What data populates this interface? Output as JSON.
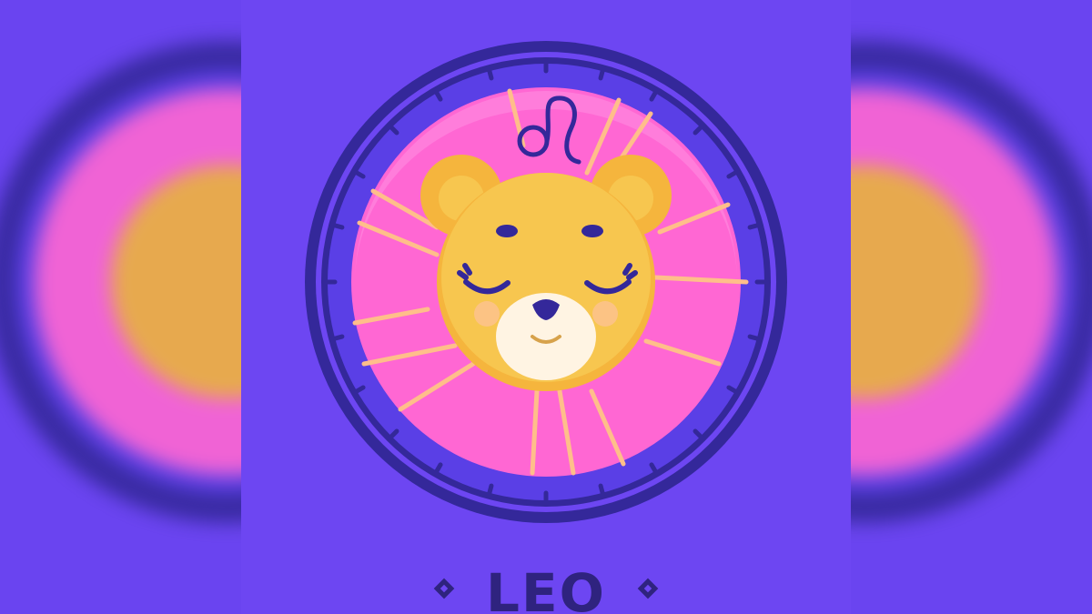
{
  "sign": {
    "name": "LEO",
    "glyph": "♌"
  },
  "colors": {
    "background": "#6a44f0",
    "ring_dark": "#34289a",
    "ring_mid": "#5a3fe6",
    "disk_pink": "#ff67d3",
    "disk_pink_light": "#ff8fe2",
    "bear_fur": "#f5b53d",
    "bear_face": "#f7c64f",
    "muzzle": "#fff4e3",
    "rays": "#ffbe8a",
    "title": "#2f237f"
  },
  "icons": {
    "sign_symbol": "leo-symbol-icon",
    "decor_left": "diamond-icon",
    "decor_right": "diamond-icon"
  }
}
